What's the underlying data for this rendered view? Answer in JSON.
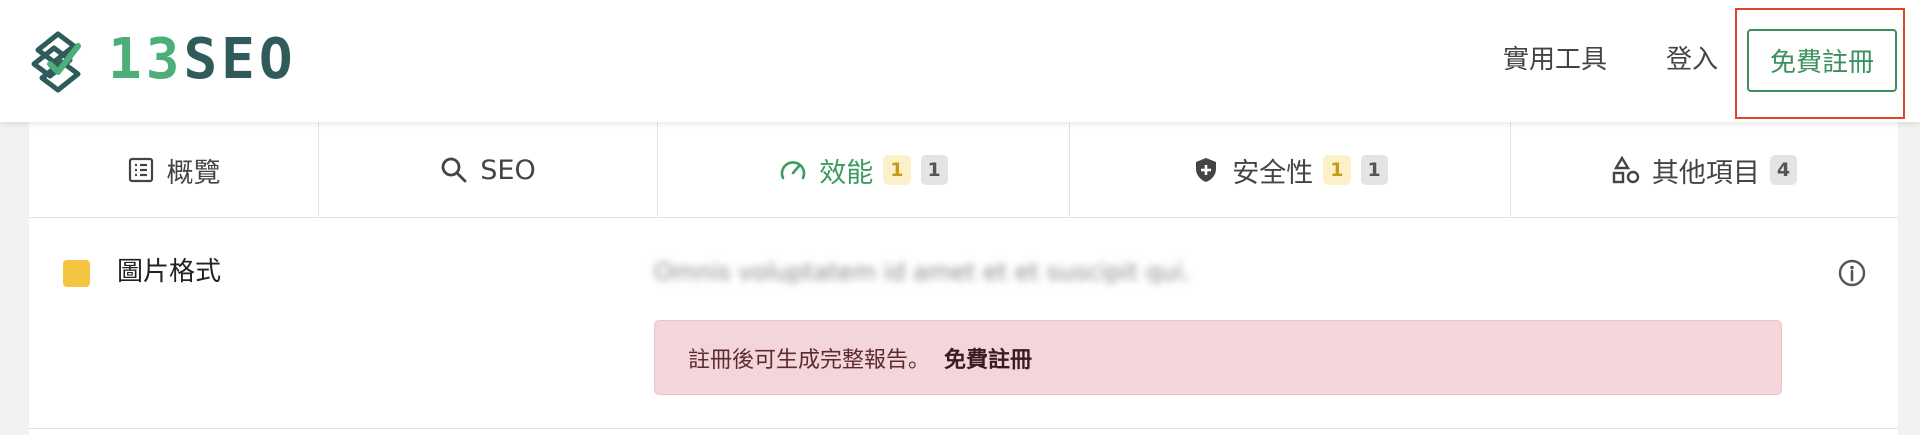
{
  "header": {
    "logo": {
      "num": "13",
      "word": "SEO"
    },
    "nav": {
      "tools": "實用工具",
      "login": "登入",
      "signup": "免費註冊"
    }
  },
  "tabs": [
    {
      "label": "概覽",
      "icon": "list-icon",
      "active": false
    },
    {
      "label": "SEO",
      "icon": "search-icon",
      "active": false
    },
    {
      "label": "效能",
      "icon": "speedometer-icon",
      "active": true,
      "warn_count": "1",
      "count": "1"
    },
    {
      "label": "安全性",
      "icon": "shield-plus-icon",
      "active": false,
      "warn_count": "1",
      "count": "1"
    },
    {
      "label": "其他項目",
      "icon": "shapes-icon",
      "active": false,
      "count": "4"
    }
  ],
  "row": {
    "title": "圖片格式",
    "description": "Omnis voluptatem id amet et et suscipit qui.",
    "alert_text": "註冊後可生成完整報告。",
    "alert_link": "免費註冊"
  },
  "colors": {
    "brand_green": "#3c8f5e",
    "active_tab": "#3c9b62",
    "warning": "#f6c443",
    "highlight": "#e0452a",
    "alert_bg": "#f3d6da"
  }
}
